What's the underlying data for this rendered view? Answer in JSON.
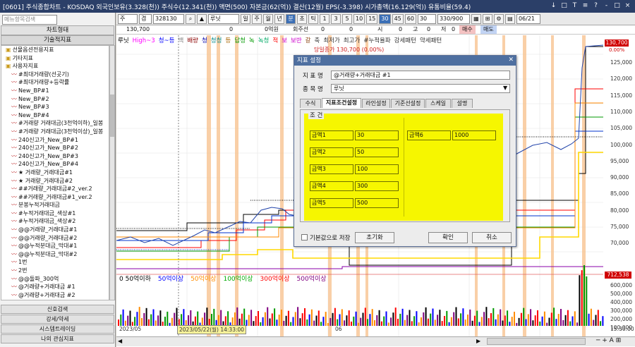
{
  "titlebar": {
    "text": "[0601] 주식종합차트 - KOSDAQ 외국인보유(3.328(천)) 주식수(12.341(천)) 액면(500) 자본금(62(억)) 결산(12월) EPS(-3.398) 시가총액(16.129(억)) 유통비율(59.4)",
    "buttons": [
      "↓",
      "□",
      "T",
      "≡",
      "?",
      "-",
      "□",
      "×"
    ]
  },
  "toolbar": {
    "type_select": "주",
    "market_select": "겸",
    "code": "328130",
    "stock_name": "루닛",
    "periods": [
      "일",
      "주",
      "월",
      "년",
      "분",
      "초",
      "틱",
      "1",
      "3",
      "5",
      "10",
      "15",
      "30",
      "45",
      "60"
    ],
    "selected_period": "30",
    "count_select": "30",
    "range": "330/900",
    "date": "06/21"
  },
  "infobar": {
    "last_price": "130,700",
    "fields": [
      "0",
      "0억원",
      "회주선",
      "0",
      "0",
      "시",
      "0",
      "고",
      "0",
      "저",
      "0"
    ],
    "buy": "매수",
    "sell": "매도"
  },
  "left_panel": {
    "search_placeholder": "메뉴항목검색",
    "sections_top": [
      "차트형태",
      "기술적지표"
    ],
    "tree": [
      "선물옵션전용지표",
      "기타지표",
      "사용자지표",
      "#최대거래량(선곳기)",
      "#최대거래량+등락률",
      "New_BP#1",
      "New_BP#2",
      "New_BP#3",
      "New_BP#4",
      "#거래량 거래대금(3천억이하)_일봉",
      "#거래량 거래대금(3천억이상)_일봉",
      "240신고가_New_BP#1",
      "240신고가_New_BP#2",
      "240신고가_New_BP#3",
      "240신고가_New_BP#4",
      "★ 거래량_거래대금#1",
      "★ 거래량_거래대금#2",
      "##거래량_거래대금#2_ver.2",
      "##거래량_거래대금#1_ver.2",
      "분봉누적거래대금",
      "#누적거래대금_색상#1",
      "#누적거래대금_색상#2",
      "@@거래량_거래대금#1",
      "@@거래량_거래대금#2",
      "@@누적분대금_막대#1",
      "@@누적분대금_막대#2",
      "1번",
      "2번",
      "@@돌파_300억",
      "@거래량+거래대금 #1",
      "@거래량+거래대금 #2"
    ],
    "sections_bottom": [
      "신호검색",
      "강세/약세",
      "시스템트레이딩",
      "나의 관심지표"
    ]
  },
  "chart": {
    "legend_top": [
      "루닛",
      "High~3",
      "청~등",
      "백",
      "배량",
      "청",
      "청청",
      "등",
      "답청",
      "녹",
      "녹청",
      "적",
      "보",
      "보반",
      "갈",
      "축",
      "최저가",
      "최고가",
      "#누적율파",
      "강세패턴",
      "약세패턴"
    ],
    "top_value_note": "당일종가 130,700 (0.00%)",
    "price_axis": [
      "125,000",
      "120,000",
      "115,000",
      "110,000",
      "105,000",
      "100,000",
      "95,000",
      "90,000",
      "85,000",
      "80,000",
      "75,000",
      "70,000"
    ],
    "price_tag": "130,700",
    "pct_tag": "0.00%",
    "volume_tag": "712,538",
    "volume_axis": [
      "600,000",
      "500,000",
      "400,000",
      "300,000",
      "200,000",
      "100,000"
    ],
    "lower_legend": [
      {
        "text": "0 50억이하",
        "color": "#000000"
      },
      {
        "text": "50억이상",
        "color": "#0000ff"
      },
      {
        "text": "50억이상",
        "color": "#ff8c00"
      },
      {
        "text": "100억이상",
        "color": "#00aa00"
      },
      {
        "text": "300억이상",
        "color": "#ff0000"
      },
      {
        "text": "500억이상",
        "color": "#800080"
      }
    ],
    "x_labels": [
      "2023/05",
      "06"
    ],
    "cursor_label": "2023/05/22(월) 14:33:00",
    "time_right": "15:30:00"
  },
  "dialog": {
    "title": "지표 설정",
    "indicator_label": "지 표 명",
    "indicator_value": "@거래량+거래대금 #1",
    "stock_label": "종 목 명",
    "stock_value": "루닛",
    "tabs": [
      "수식",
      "지표조건설정",
      "라인설정",
      "기준선설정",
      "스케일",
      "설명"
    ],
    "active_tab": "지표조건설정",
    "group_label": "조 건",
    "conditions_left": [
      {
        "name": "금액1",
        "value": "30"
      },
      {
        "name": "금액2",
        "value": "50"
      },
      {
        "name": "금액3",
        "value": "100"
      },
      {
        "name": "금액4",
        "value": "300"
      },
      {
        "name": "금액5",
        "value": "500"
      }
    ],
    "conditions_right": [
      {
        "name": "금액6",
        "value": "1000"
      }
    ],
    "save_default": "기본값으로 저장",
    "reset_button": "초기화",
    "ok_button": "확인",
    "cancel_button": "취소"
  }
}
